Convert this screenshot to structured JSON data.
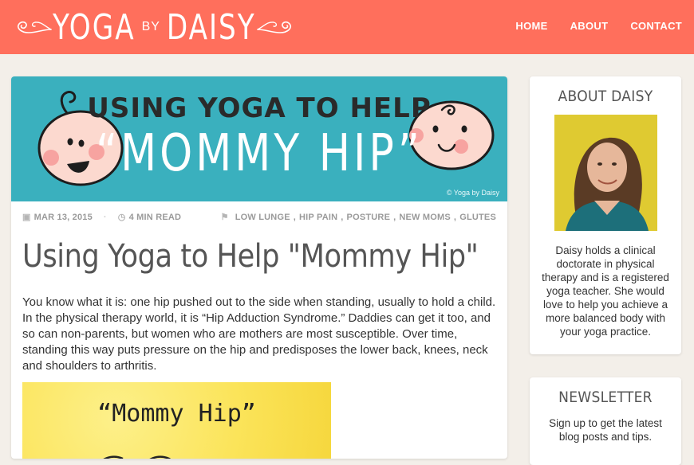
{
  "header": {
    "logo": {
      "word1": "YOGA",
      "by": "BY",
      "word2": "DAISY"
    },
    "nav": [
      {
        "label": "HOME"
      },
      {
        "label": "ABOUT"
      },
      {
        "label": "CONTACT"
      }
    ],
    "bg_color": "#ff6f5c"
  },
  "post": {
    "banner": {
      "line1": "USING YOGA TO HELP",
      "line2": "“MOMMY HIP”",
      "credit": "© Yoga by Daisy",
      "bg_color": "#3ab0be"
    },
    "meta": {
      "date": "MAR 13, 2015",
      "read_time": "4 MIN READ",
      "tags": [
        "LOW LUNGE",
        "HIP PAIN",
        "POSTURE",
        "NEW MOMS",
        "GLUTES"
      ],
      "icons": [
        "calendar-icon",
        "clock-icon",
        "tag-icon"
      ]
    },
    "title": "Using Yoga to Help \"Mommy Hip\"",
    "body": "You know what it is: one hip pushed out to the side when standing, usually to hold a child. In the physical therapy world, it is “Hip Adduction Syndrome.” Daddies can get it too, and so can non-parents, but women who are mothers are most susceptible. Over time, standing this way puts pressure on the hip and predisposes the lower back, knees, neck and shoulders to arthritis.",
    "inline_image": {
      "caption": "“Mommy Hip”",
      "bg_color": "#fbe45a"
    }
  },
  "sidebar": {
    "about": {
      "title": "ABOUT DAISY",
      "text": "Daisy holds a clinical doctorate in physical therapy and is a registered yoga teacher. She would love to help you achieve a more balanced body with your yoga practice."
    },
    "newsletter": {
      "title": "NEWSLETTER",
      "text": "Sign up to get the latest blog posts and tips."
    }
  }
}
